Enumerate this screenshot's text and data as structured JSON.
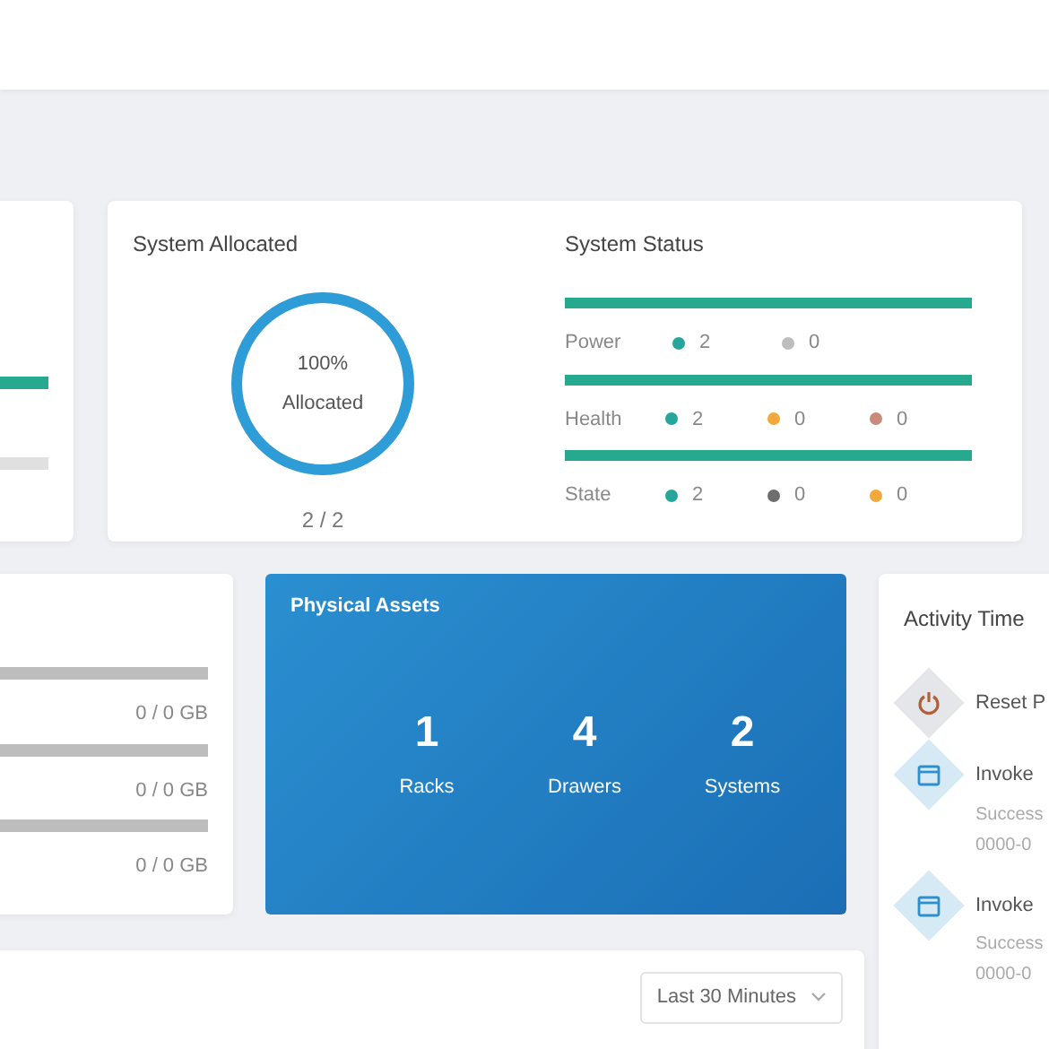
{
  "capacity_card": {
    "bars": [
      {
        "color": "#26a98e"
      },
      {
        "color": "#e0e0e0"
      }
    ]
  },
  "system_allocated": {
    "title": "System Allocated",
    "level": 1,
    "percent": "100%",
    "label": "Allocated",
    "count": "2 / 2"
  },
  "system_status": {
    "title": "System Status",
    "rows": [
      {
        "label": "Power",
        "level": 1,
        "counts": [
          {
            "color": "#26a69a",
            "value": "2"
          },
          {
            "color": "#bdbdbd",
            "value": "0"
          }
        ]
      },
      {
        "label": "Health",
        "level": 1,
        "counts": [
          {
            "color": "#26a69a",
            "value": "2"
          },
          {
            "color": "#f2a93b",
            "value": "0"
          },
          {
            "color": "#c98a7a",
            "value": "0"
          }
        ]
      },
      {
        "label": "State",
        "level": 1,
        "counts": [
          {
            "color": "#26a69a",
            "value": "2"
          },
          {
            "color": "#6e6e6e",
            "value": "0"
          },
          {
            "color": "#f2a93b",
            "value": "0"
          }
        ]
      }
    ]
  },
  "storage_card": {
    "rows": [
      {
        "reading": "0 / 0 GB"
      },
      {
        "reading": "0 / 0 GB"
      },
      {
        "reading": "0 / 0 GB"
      }
    ]
  },
  "physical_assets": {
    "title": "Physical Assets",
    "stats": [
      {
        "value": "1",
        "label": "Racks"
      },
      {
        "value": "4",
        "label": "Drawers"
      },
      {
        "value": "2",
        "label": "Systems"
      }
    ]
  },
  "activity_timeline": {
    "title": "Activity Time",
    "events": [
      {
        "kind": "power",
        "title": "Reset P"
      },
      {
        "kind": "task",
        "title": "Invoke",
        "status": "Success",
        "time": "0000-0"
      },
      {
        "kind": "task",
        "title": "Invoke",
        "status": "Success",
        "time": "0000-0"
      }
    ]
  },
  "metrics_card": {
    "range_select": "Last 30 Minutes"
  }
}
